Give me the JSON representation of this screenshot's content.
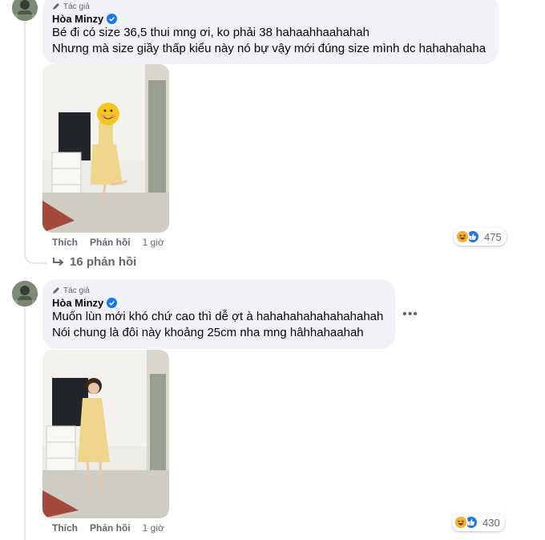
{
  "comments": [
    {
      "badge": "Tác giả",
      "author": "Hòa Minzy",
      "lines": [
        "Bé đi có size 36,5 thui mng ơi, ko phải 38 hahaahhaahahah",
        "Nhưng mà size giầy thấp kiểu này nó bự vậy mới đúng size mình dc hahahahaha"
      ],
      "actions": {
        "like": "Thích",
        "reply": "Phản hồi",
        "time": "1 giờ"
      },
      "reaction_count": "475",
      "reactions": [
        "haha-icon",
        "like-icon"
      ]
    },
    {
      "badge": "Tác giả",
      "author": "Hòa Minzy",
      "lines": [
        "Muốn lùn mới khó chứ cao thì dễ ợt à hahahahahahahahahah",
        "Nói chung là đôi này khoảng 25cm nha mng hâhhahaahah"
      ],
      "actions": {
        "like": "Thích",
        "reply": "Phản hồi",
        "time": "1 giờ"
      },
      "reaction_count": "430",
      "reactions": [
        "haha-icon",
        "like-icon"
      ]
    }
  ],
  "replies_link": "16 phản hồi",
  "more_button": "•••",
  "colors": {
    "bubble": "#f0f2f5",
    "verified": "#1877f2",
    "muted": "#65676b",
    "haha": "#f7b125"
  }
}
